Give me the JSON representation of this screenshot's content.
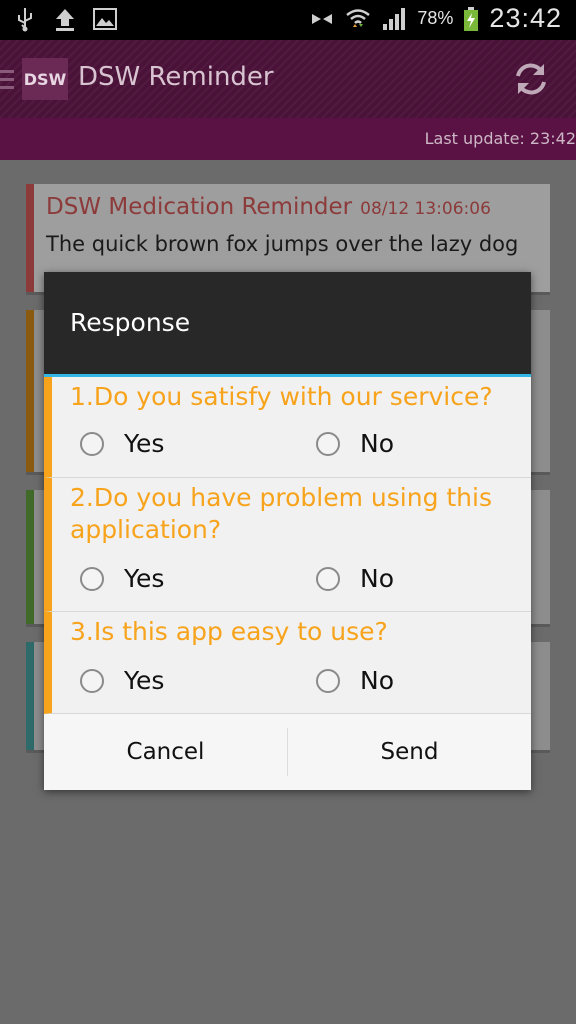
{
  "status_bar": {
    "battery_percent": "78%",
    "clock": "23:42",
    "icons": [
      "usb-icon",
      "upload-icon",
      "image-icon",
      "nfc-icon",
      "wifi-icon",
      "signal-icon",
      "battery-charging-icon"
    ]
  },
  "app": {
    "logo_text": "DSW",
    "title": "DSW Reminder",
    "last_update": "Last update: 23:42"
  },
  "cards": [
    {
      "title": "DSW Medication Reminder",
      "date": "08/12 13:06:06",
      "message": "The quick brown fox jumps over the lazy dog",
      "color": "#8c3a3a"
    }
  ],
  "dialog": {
    "title": "Response",
    "questions": [
      {
        "text": "1.Do you satisfy with our service?",
        "options": [
          "Yes",
          "No"
        ]
      },
      {
        "text": "2.Do you have problem using this application?",
        "options": [
          "Yes",
          "No"
        ]
      },
      {
        "text": "3.Is this app easy to use?",
        "options": [
          "Yes",
          "No"
        ]
      }
    ],
    "cancel_label": "Cancel",
    "send_label": "Send"
  },
  "colors": {
    "accent": "#f7a31c",
    "header_divider": "#33b5e5",
    "action_bar": "#4a1238"
  }
}
